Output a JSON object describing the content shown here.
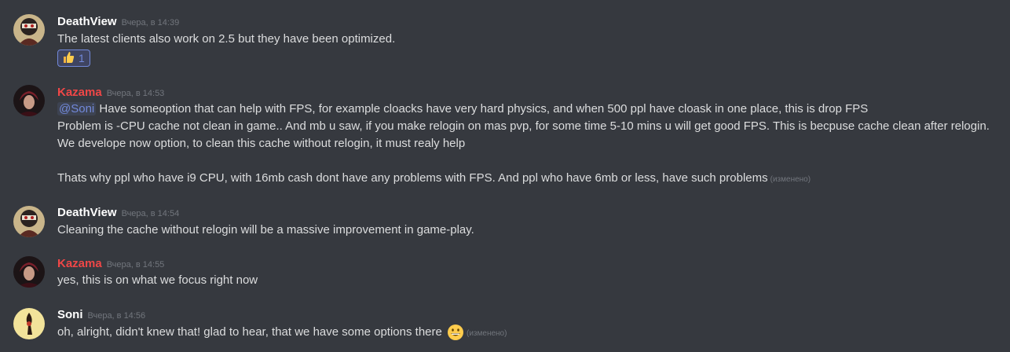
{
  "messages": [
    {
      "author": "DeathView",
      "author_color": "#ffffff",
      "timestamp": "Вчера, в 14:39",
      "lines": [
        "The latest clients also work on 2.5 but they have been optimized."
      ],
      "reaction": {
        "emoji": "thumbs-up",
        "count": "1"
      }
    },
    {
      "author": "Kazama",
      "author_color": "#f04747",
      "timestamp": "Вчера, в 14:53",
      "mention": "@Soni",
      "lines": [
        "Have someoption that can help with FPS, for example cloacks have very hard physics, and when 500 ppl have cloask in one place, this is drop FPS",
        "Problem is -CPU cache  not clean in game.. And mb u saw, if you make relogin on mas pvp, for some time 5-10 mins u will get good FPS. This is becpuse cache clean after relogin.",
        "We develope now option, to clean this cache without relogin, it must realy help",
        "Thats why ppl who have i9 CPU, with 16mb cash dont have any problems with FPS. And ppl who have 6mb or less, have such problems"
      ],
      "edited": "(изменено)"
    },
    {
      "author": "DeathView",
      "author_color": "#ffffff",
      "timestamp": "Вчера, в 14:54",
      "lines": [
        "Cleaning the cache without relogin will be a massive improvement in game-play."
      ]
    },
    {
      "author": "Kazama",
      "author_color": "#f04747",
      "timestamp": "Вчера, в 14:55",
      "lines": [
        "yes, this is on what we focus right now"
      ]
    },
    {
      "author": "Soni",
      "author_color": "#ffffff",
      "timestamp": "Вчера, в 14:56",
      "lines": [
        "oh, alright, didn't knew that! glad to hear, that we have some options there"
      ],
      "emoji": "grinning-face",
      "edited": "(изменено)"
    }
  ]
}
